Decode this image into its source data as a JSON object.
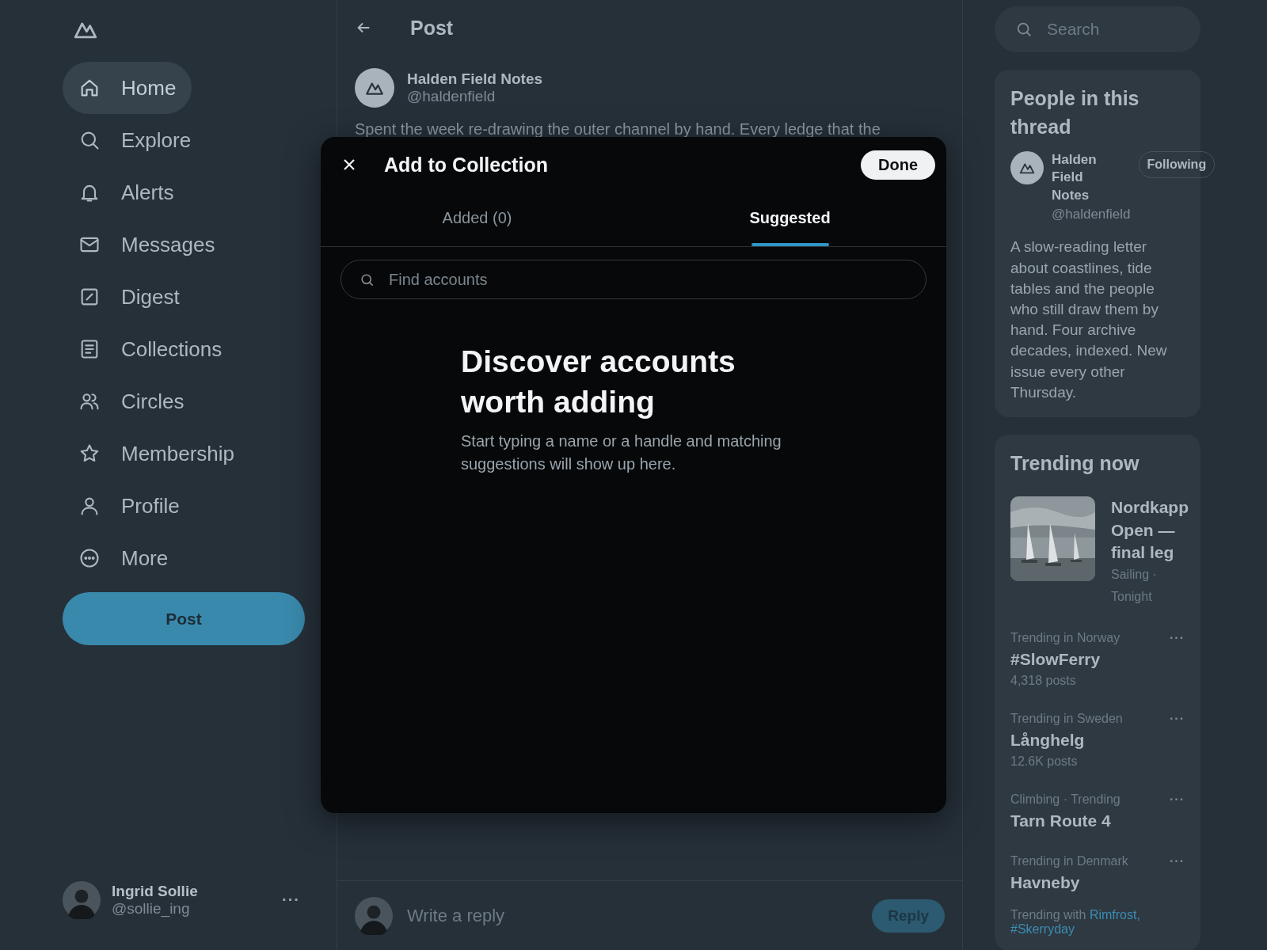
{
  "nav": {
    "items": [
      {
        "label": "Home",
        "selected": true
      },
      {
        "label": "Explore",
        "selected": false
      },
      {
        "label": "Alerts",
        "selected": false
      },
      {
        "label": "Messages",
        "selected": false
      },
      {
        "label": "Digest",
        "selected": false
      },
      {
        "label": "Collections",
        "selected": false
      },
      {
        "label": "Circles",
        "selected": false
      },
      {
        "label": "Membership",
        "selected": false
      },
      {
        "label": "Profile",
        "selected": false
      },
      {
        "label": "More",
        "selected": false
      }
    ],
    "post_button": "Post",
    "account": {
      "name": "Ingrid Sollie",
      "handle": "@sollie_ing",
      "menu": "···"
    }
  },
  "post": {
    "title": "Post",
    "author": "Halden Field Notes",
    "handle": "@haldenfield",
    "text": "Spent the week re-drawing the outer channel by hand. Every ledge that the"
  },
  "reply_bar": {
    "placeholder": "Write a reply",
    "button": "Reply"
  },
  "dialog": {
    "title": "Add to Collection",
    "done": "Done",
    "tabs": [
      {
        "label": "Added (0)",
        "selected": false
      },
      {
        "label": "Suggested",
        "selected": true
      }
    ],
    "search": {
      "placeholder": "Find accounts"
    },
    "empty": {
      "heading": "Discover accounts worth adding",
      "body": "Start typing a name or a handle and matching suggestions will show up here."
    }
  },
  "search": {
    "placeholder": "Search"
  },
  "people": {
    "title": "People in this thread",
    "person": {
      "name": "Halden Field Notes",
      "handle": "@haldenfield",
      "button": "Following",
      "bio": "A slow-reading letter about coastlines, tide tables and the people who still draw them by hand. Four archive decades, indexed. New issue every other Thursday."
    }
  },
  "trending": {
    "title": "Trending now",
    "feature": {
      "kind": "picture",
      "title": "Nordkapp Open — final leg",
      "meta": "Sailing · Tonight"
    },
    "items": [
      {
        "context": "Trending in Norway",
        "topic": "#SlowFerry",
        "count": "4,318 posts",
        "menu": "···"
      },
      {
        "context": "Trending in Sweden",
        "topic": "Långhelg",
        "count": "12.6K posts",
        "menu": "···"
      },
      {
        "context": "Climbing · Trending",
        "topic": "Tarn Route 4",
        "menu": "···"
      },
      {
        "context": "Trending in Denmark",
        "topic": "Havneby",
        "menu": "···",
        "with": {
          "prefix": "Trending with",
          "links": [
            "Rimfrost,",
            "#Skerryday"
          ]
        }
      }
    ]
  }
}
